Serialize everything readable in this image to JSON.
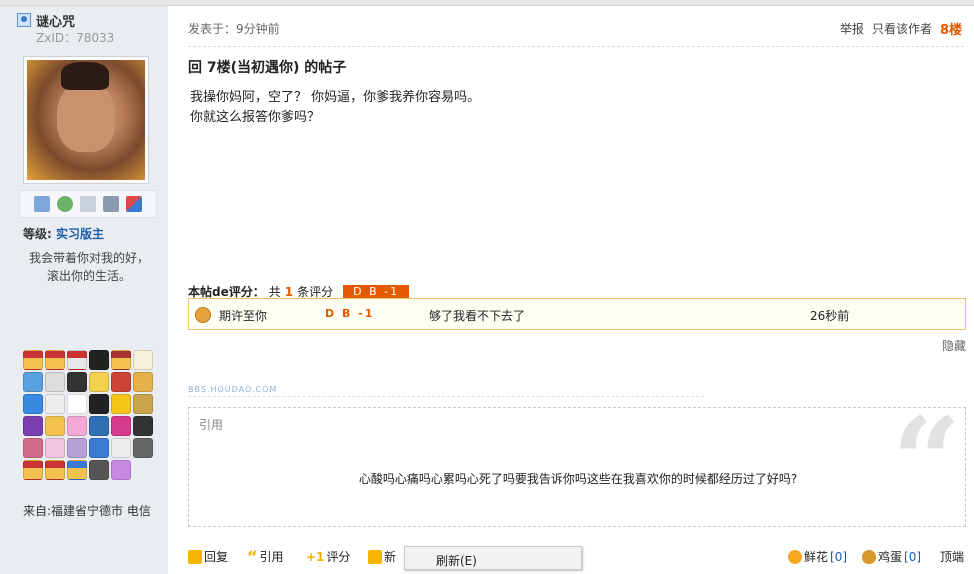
{
  "user": {
    "name": "谜心咒",
    "zxid": "ZxID：78033",
    "level_label": "等级:",
    "level_value": "实习版主",
    "signature_line1": "我会带着你对我的好，",
    "signature_line2": "滚出你的生活。",
    "from": "来自:福建省宁德市 电信"
  },
  "post": {
    "posted_at": "发表于：9分钟前",
    "report": "举报",
    "only_author": "只看该作者",
    "floor": "8楼",
    "title": "回 7楼(当初遇你) 的帖子",
    "body_line1": "我操你妈阿，空了？   你妈逼，你爹我养你容易吗。",
    "body_line2": "你就这么报答你爹吗？"
  },
  "rating": {
    "label": "本帖de评分：",
    "total_prefix": "共",
    "total_count": "1",
    "total_suffix": "条评分",
    "badge": "D B -1",
    "rows": [
      {
        "rater": "期许至你",
        "score": "D B -1",
        "reason": "够了我看不下去了",
        "time": "26秒前"
      }
    ],
    "hide": "隐藏"
  },
  "watermark": "BBS.HOUDAO.COM",
  "quote": {
    "label": "引用",
    "text": "心酸吗心痛吗心累吗心死了吗要我告诉你吗这些在我喜欢你的时候都经历过了好吗?"
  },
  "actions": {
    "reply": "回复",
    "quote": "引用",
    "rate": "评分",
    "new_prefix": "新",
    "flower": "鲜花",
    "flower_count": "[0]",
    "egg": "鸡蛋",
    "egg_count": "[0]",
    "top": "顶端"
  },
  "context_menu": {
    "refresh": "刷新(E)"
  },
  "colors": {
    "accent_orange": "#e55a00",
    "link_blue": "#1c5fa8",
    "sidebar_bg": "#e9edf2",
    "rating_border": "#f0c36d"
  }
}
